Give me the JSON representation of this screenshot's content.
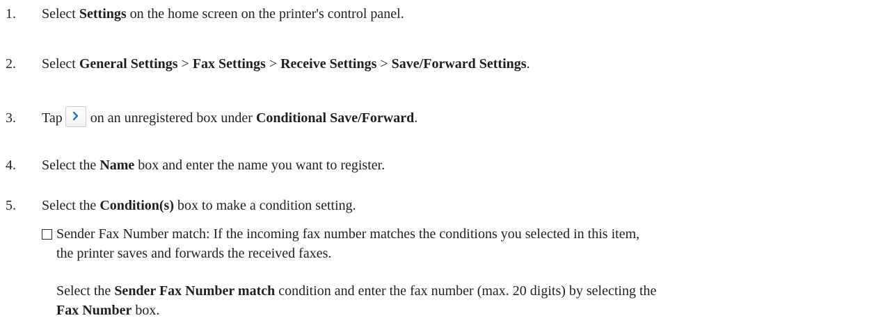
{
  "steps": [
    {
      "num": "1.",
      "t1": "Select ",
      "b1": "Settings",
      "t2": " on the home screen on the printer's control panel."
    },
    {
      "num": "2.",
      "t1": "Select ",
      "b1": "General Settings",
      "sep1": " > ",
      "b2": "Fax Settings",
      "sep2": " > ",
      "b3": "Receive Settings",
      "sep3": " > ",
      "b4": "Save/Forward Settings",
      "end": "."
    },
    {
      "num": "3.",
      "t1": "Tap",
      "icon": "chevron-right-icon",
      "t2": "on an unregistered box under ",
      "b1": "Conditional Save/Forward",
      "end": "."
    },
    {
      "num": "4.",
      "t1": "Select the ",
      "b1": "Name",
      "t2": " box and enter the name you want to register."
    },
    {
      "num": "5.",
      "t1": "Select the ",
      "b1": "Condition(s)",
      "t2": " box to make a condition setting."
    }
  ],
  "option": {
    "icon": "checkbox-icon",
    "line1": "Sender Fax Number match: If the incoming fax number matches the conditions you selected in this item,",
    "line2": "the printer saves and forwards the received faxes."
  },
  "detail": {
    "t1": "Select the ",
    "b1": "Sender Fax Number match",
    "t2": " condition and enter the fax number (max. 20 digits) by selecting the",
    "b2": "Fax Number",
    "t3": " box."
  }
}
